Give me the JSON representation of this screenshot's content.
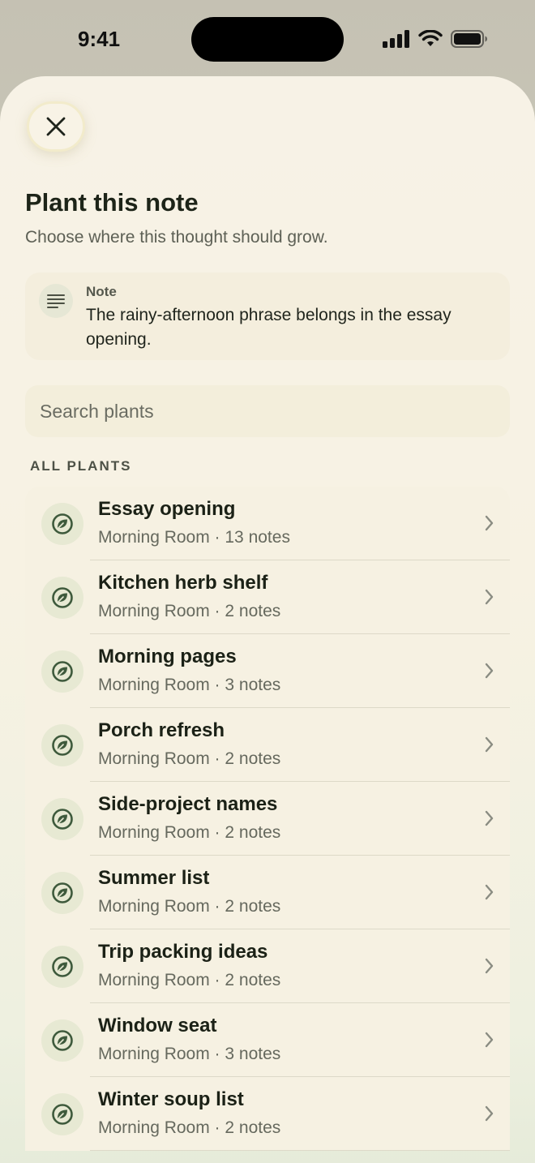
{
  "status_bar": {
    "time": "9:41"
  },
  "sheet": {
    "title": "Plant this note",
    "subtitle": "Choose where this thought should grow.",
    "note_card": {
      "label": "Note",
      "text": "The rainy-afternoon phrase belongs in the essay opening."
    },
    "search": {
      "placeholder": "Search plants"
    },
    "section_header": "ALL PLANTS",
    "plants": [
      {
        "name": "Essay opening",
        "meta": "Morning Room · 13 notes"
      },
      {
        "name": "Kitchen herb shelf",
        "meta": "Morning Room · 2 notes"
      },
      {
        "name": "Morning pages",
        "meta": "Morning Room · 3 notes"
      },
      {
        "name": "Porch refresh",
        "meta": "Morning Room · 2 notes"
      },
      {
        "name": "Side-project names",
        "meta": "Morning Room · 2 notes"
      },
      {
        "name": "Summer list",
        "meta": "Morning Room · 2 notes"
      },
      {
        "name": "Trip packing ideas",
        "meta": "Morning Room · 2 notes"
      },
      {
        "name": "Window seat",
        "meta": "Morning Room · 3 notes"
      },
      {
        "name": "Winter soup list",
        "meta": "Morning Room · 2 notes"
      }
    ]
  },
  "icons": {
    "close": "close-icon",
    "note": "note-lines-icon",
    "plant": "leaf-icon",
    "chevron": "chevron-right-icon"
  },
  "colors": {
    "accent_green": "#3e5a3c",
    "sheet_background": "#f7f2e6"
  }
}
